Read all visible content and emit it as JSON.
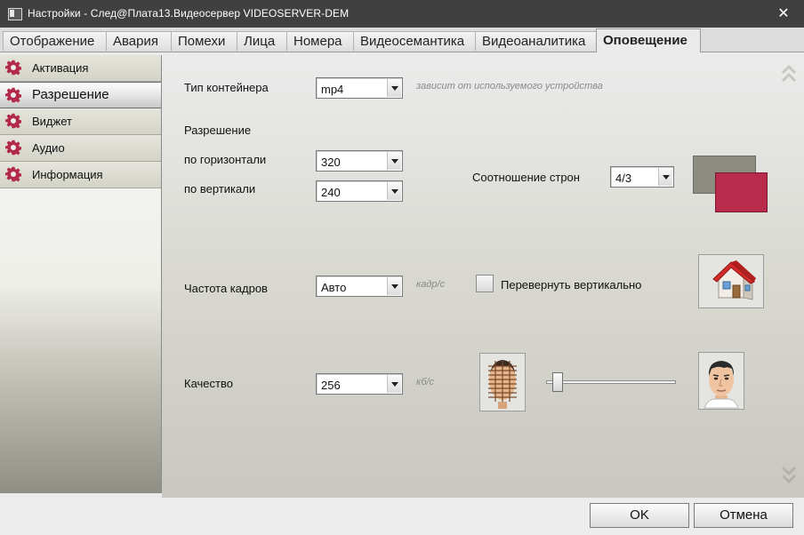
{
  "window": {
    "title": "Настройки - След@Плата13.Видеосервер VIDEOSERVER-DEM",
    "close_glyph": "✕"
  },
  "tabs": [
    {
      "label": "Отображение"
    },
    {
      "label": "Авария"
    },
    {
      "label": "Помехи"
    },
    {
      "label": "Лица"
    },
    {
      "label": "Номера"
    },
    {
      "label": "Видеосемантика"
    },
    {
      "label": "Видеоаналитика"
    },
    {
      "label": "Оповещение",
      "active": true
    }
  ],
  "sidebar": {
    "items": [
      {
        "label": "Активация"
      },
      {
        "label": "Разрешение",
        "active": true
      },
      {
        "label": "Виджет"
      },
      {
        "label": "Аудио"
      },
      {
        "label": "Информация"
      }
    ],
    "icon_color": "#b2294a"
  },
  "form": {
    "container": {
      "label": "Тип контейнера",
      "value": "mp4",
      "hint": "зависит от используемого устройства"
    },
    "resolution": {
      "label": "Разрешение",
      "horizontal": {
        "label": "по горизонтали",
        "value": "320"
      },
      "vertical": {
        "label": "по вертикали",
        "value": "240"
      }
    },
    "aspect": {
      "label": "Соотношение строн",
      "value": "4/3",
      "back_color": "#8c8c80",
      "front_color": "#b82b4b"
    },
    "framerate": {
      "label": "Частота кадров",
      "value": "Авто",
      "hint": "кадр/с"
    },
    "flip": {
      "label": "Перевернуть вертикально",
      "checked": false
    },
    "quality": {
      "label": "Качество",
      "value": "256",
      "hint": "кб/с",
      "slider_level": 0.05
    }
  },
  "icons": {
    "scroll_up": "double-chevron-up-icon",
    "scroll_down": "double-chevron-down-icon",
    "house": "house-icon",
    "low_quality_face": "pixelated-face-icon",
    "high_quality_face": "face-icon"
  },
  "footer": {
    "ok_label": "OK",
    "cancel_label": "Отмена"
  }
}
